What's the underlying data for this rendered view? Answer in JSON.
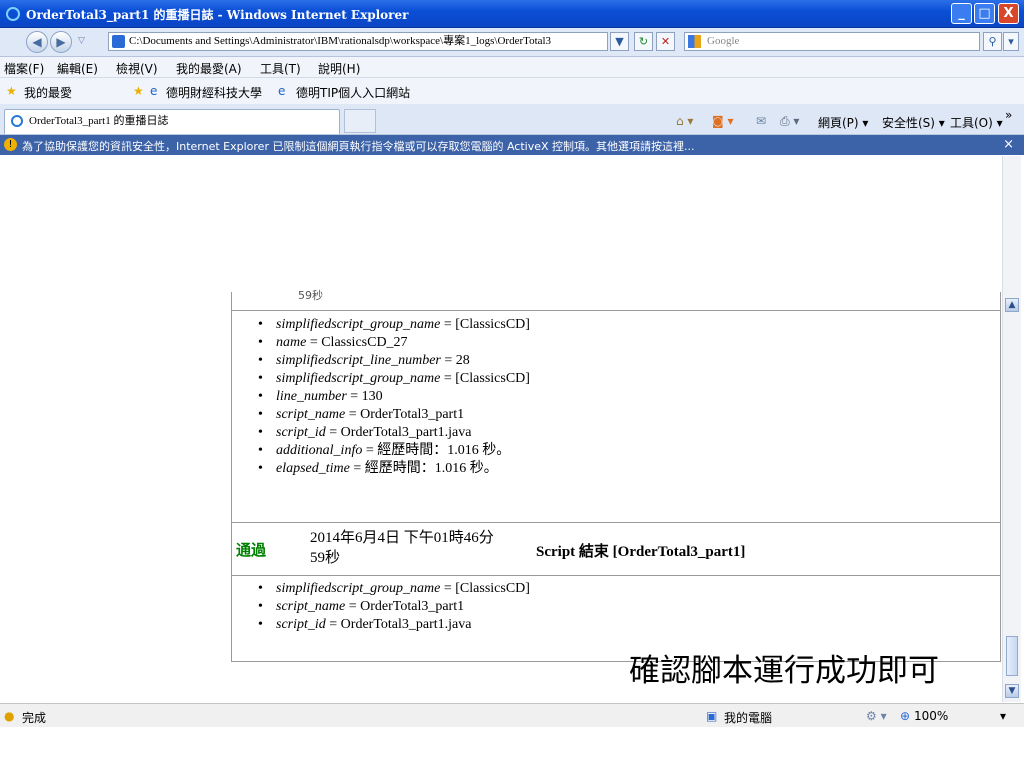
{
  "window": {
    "title": "OrderTotal3_part1 的重播日誌 - Windows Internet Explorer",
    "min": "_",
    "max": "□",
    "close": "X"
  },
  "address": {
    "url": "C:\\Documents and Settings\\Administrator\\IBM\\rationalsdp\\workspace\\專案1_logs\\OrderTotal3",
    "search_placeholder": "Google"
  },
  "menu": [
    "檔案(F)",
    "編輯(E)",
    "檢視(V)",
    "我的最愛(A)",
    "工具(T)",
    "說明(H)"
  ],
  "favorites": {
    "label": "我的最愛",
    "links": [
      "德明財經科技大學",
      "德明TIP個人入口網站"
    ]
  },
  "tab": {
    "label": "OrderTotal3_part1 的重播日誌"
  },
  "commands": {
    "page": "網頁(P)",
    "safety": "安全性(S)",
    "tools": "工具(O)"
  },
  "infobar": {
    "text": "為了協助保護您的資訊安全性，Internet Explorer 已限制這個網頁執行指令檔或可以存取您電腦的 ActiveX 控制項。其他選項請按這裡...",
    "close": "×"
  },
  "log": {
    "cut_text": "59秒",
    "block1": [
      {
        "key": "simplifiedscript_group_name",
        "value": " = [ClassicsCD]"
      },
      {
        "key": "name",
        "value": " = ClassicsCD_27"
      },
      {
        "key": "simplifiedscript_line_number",
        "value": " = 28"
      },
      {
        "key": "simplifiedscript_group_name",
        "value": " = [ClassicsCD]"
      },
      {
        "key": "line_number",
        "value": " = 130"
      },
      {
        "key": "script_name",
        "value": " = OrderTotal3_part1"
      },
      {
        "key": "script_id",
        "value": " = OrderTotal3_part1.java"
      },
      {
        "key": "additional_info",
        "value": " = 經歷時間：1.016 秒。"
      },
      {
        "key": "elapsed_time",
        "value": " = 經歷時間：1.016 秒。"
      }
    ],
    "result": "通過",
    "timestamp_line1": "2014年6月4日 下午01時46分",
    "timestamp_line2": "59秒",
    "end_message": "Script 結束 [OrderTotal3_part1]",
    "block2": [
      {
        "key": "simplifiedscript_group_name",
        "value": " = [ClassicsCD]"
      },
      {
        "key": "script_name",
        "value": " = OrderTotal3_part1"
      },
      {
        "key": "script_id",
        "value": " = OrderTotal3_part1.java"
      }
    ]
  },
  "caption": "確認腳本運行成功即可",
  "status": {
    "left": "完成",
    "zone": "我的電腦",
    "zoom": "100%"
  }
}
